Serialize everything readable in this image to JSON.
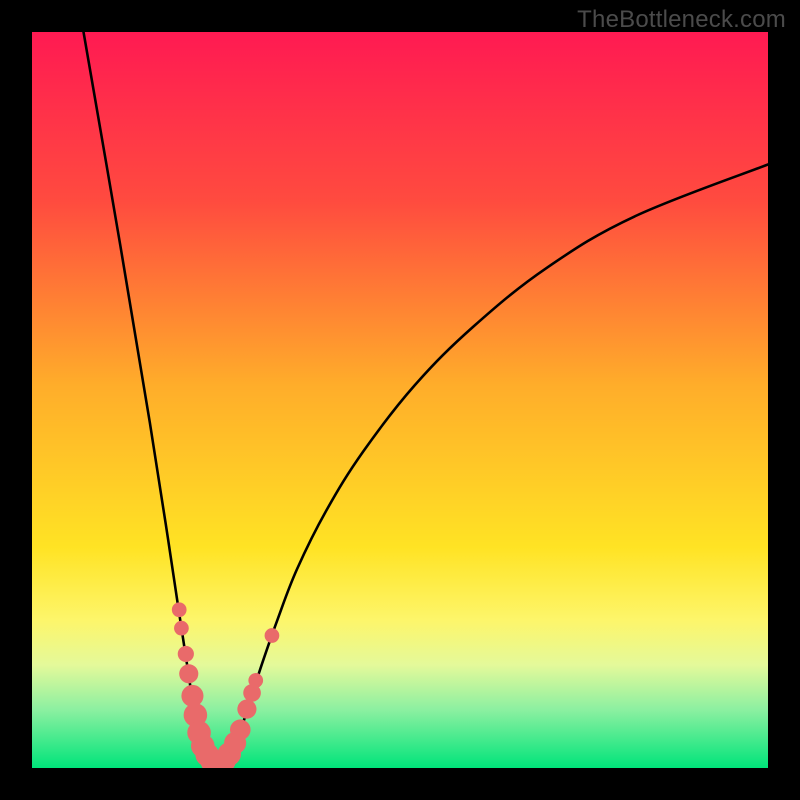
{
  "watermark": "TheBottleneck.com",
  "chart_data": {
    "type": "line",
    "title": "",
    "xlabel": "",
    "ylabel": "",
    "xlim": [
      0,
      100
    ],
    "ylim": [
      0,
      100
    ],
    "grid": false,
    "background_gradient": {
      "stops": [
        {
          "pos": 0,
          "color": "#ff1a52"
        },
        {
          "pos": 23,
          "color": "#ff4b3f"
        },
        {
          "pos": 48,
          "color": "#ffad2a"
        },
        {
          "pos": 70,
          "color": "#ffe324"
        },
        {
          "pos": 80,
          "color": "#fdf66b"
        },
        {
          "pos": 86,
          "color": "#e4f99a"
        },
        {
          "pos": 92,
          "color": "#8df0a1"
        },
        {
          "pos": 100,
          "color": "#00e47a"
        }
      ]
    },
    "series": [
      {
        "name": "left-arm",
        "values": [
          {
            "x": 7,
            "y": 100
          },
          {
            "x": 12,
            "y": 71
          },
          {
            "x": 16,
            "y": 47
          },
          {
            "x": 18.5,
            "y": 31
          },
          {
            "x": 20,
            "y": 21
          },
          {
            "x": 21,
            "y": 14.5
          },
          {
            "x": 21.8,
            "y": 9.3
          },
          {
            "x": 22.6,
            "y": 5
          },
          {
            "x": 23.5,
            "y": 2
          },
          {
            "x": 24.4,
            "y": 0.6
          },
          {
            "x": 25.3,
            "y": 0.15
          }
        ]
      },
      {
        "name": "right-arm",
        "values": [
          {
            "x": 25.3,
            "y": 0.15
          },
          {
            "x": 26.2,
            "y": 0.6
          },
          {
            "x": 27.2,
            "y": 2.2
          },
          {
            "x": 28.3,
            "y": 5
          },
          {
            "x": 29.6,
            "y": 9
          },
          {
            "x": 31.2,
            "y": 14
          },
          {
            "x": 33.3,
            "y": 20
          },
          {
            "x": 36,
            "y": 27
          },
          {
            "x": 40,
            "y": 35
          },
          {
            "x": 45,
            "y": 43
          },
          {
            "x": 52,
            "y": 52
          },
          {
            "x": 60,
            "y": 60
          },
          {
            "x": 70,
            "y": 68
          },
          {
            "x": 82,
            "y": 75
          },
          {
            "x": 100,
            "y": 82
          }
        ]
      }
    ],
    "markers": [
      {
        "x": 20.0,
        "y": 21.5,
        "r": 1.0
      },
      {
        "x": 20.3,
        "y": 19.0,
        "r": 1.0
      },
      {
        "x": 20.9,
        "y": 15.5,
        "r": 1.1
      },
      {
        "x": 21.3,
        "y": 12.8,
        "r": 1.3
      },
      {
        "x": 21.8,
        "y": 9.8,
        "r": 1.5
      },
      {
        "x": 22.2,
        "y": 7.2,
        "r": 1.6
      },
      {
        "x": 22.7,
        "y": 4.8,
        "r": 1.6
      },
      {
        "x": 23.2,
        "y": 3.0,
        "r": 1.6
      },
      {
        "x": 23.8,
        "y": 1.8,
        "r": 1.6
      },
      {
        "x": 24.5,
        "y": 0.9,
        "r": 1.6
      },
      {
        "x": 25.3,
        "y": 0.6,
        "r": 1.6
      },
      {
        "x": 26.1,
        "y": 1.0,
        "r": 1.6
      },
      {
        "x": 26.8,
        "y": 1.9,
        "r": 1.6
      },
      {
        "x": 27.6,
        "y": 3.4,
        "r": 1.5
      },
      {
        "x": 28.3,
        "y": 5.2,
        "r": 1.4
      },
      {
        "x": 29.2,
        "y": 8.0,
        "r": 1.3
      },
      {
        "x": 29.9,
        "y": 10.2,
        "r": 1.2
      },
      {
        "x": 30.4,
        "y": 11.9,
        "r": 1.0
      },
      {
        "x": 32.6,
        "y": 18.0,
        "r": 1.0
      }
    ],
    "marker_color": "#e96a6a"
  }
}
